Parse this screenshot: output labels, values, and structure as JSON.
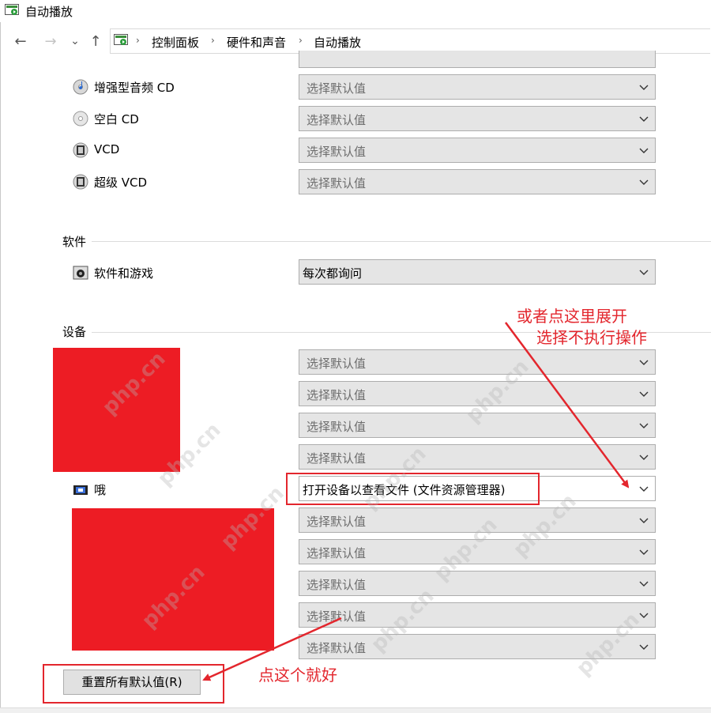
{
  "window": {
    "title": "自动播放"
  },
  "breadcrumb": [
    "控制面板",
    "硬件和声音",
    "自动播放"
  ],
  "nav": {
    "back": "←",
    "forward": "→",
    "recent": "⌄",
    "up": "↑",
    "separator": "›"
  },
  "media_rows": [
    {
      "label": "增强型音频 CD",
      "value": "选择默认值",
      "icon": "audio-cd-icon"
    },
    {
      "label": "空白 CD",
      "value": "选择默认值",
      "icon": "blank-cd-icon"
    },
    {
      "label": "VCD",
      "value": "选择默认值",
      "icon": "vcd-icon"
    },
    {
      "label": "超级 VCD",
      "value": "选择默认值",
      "icon": "svcd-icon"
    }
  ],
  "software_section": {
    "title": "软件",
    "row": {
      "label": "软件和游戏",
      "value": "每次都询问",
      "icon": "software-icon"
    }
  },
  "devices_section": {
    "title": "设备",
    "dropdowns_before": [
      "选择默认值",
      "选择默认值",
      "选择默认值",
      "选择默认值"
    ],
    "highlighted_row": {
      "label": "哦",
      "value": "打开设备以查看文件 (文件资源管理器)",
      "icon": "device-icon"
    },
    "dropdowns_after": [
      "选择默认值",
      "选择默认值",
      "选择默认值",
      "选择默认值",
      "选择默认值"
    ]
  },
  "reset_button": {
    "label": "重置所有默认值(R)"
  },
  "annotations": {
    "top_right_line1": "或者点这里展开",
    "top_right_line2": "选择不执行操作",
    "bottom": "点这个就好",
    "color": "#e3262d"
  },
  "watermark": "php.cn"
}
